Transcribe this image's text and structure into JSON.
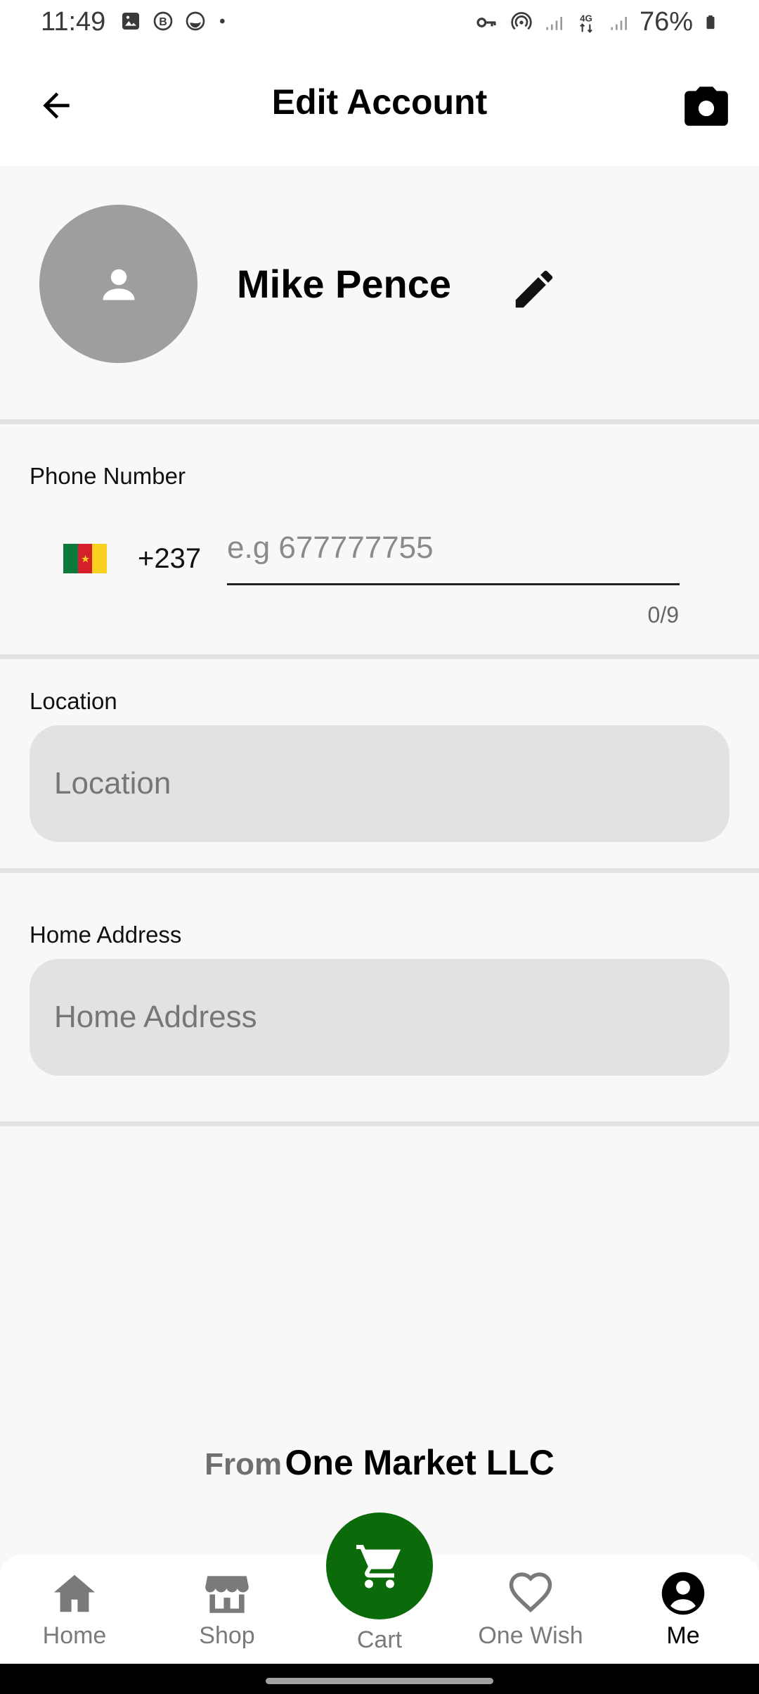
{
  "status_bar": {
    "time": "11:49",
    "battery": "76%",
    "icons_left": [
      "gallery-icon",
      "b-badge-icon",
      "vpn-app-icon",
      "dot-icon"
    ],
    "icons_right": [
      "key-icon",
      "hotspot-icon",
      "signal-icon",
      "4g-icon",
      "signal-icon-2",
      "battery-icon"
    ]
  },
  "app_bar": {
    "title": "Edit Account",
    "back_icon": "arrow-left-icon",
    "camera_icon": "camera-icon"
  },
  "profile": {
    "name": "Mike Pence",
    "avatar_icon": "person-icon",
    "edit_icon": "pencil-icon"
  },
  "phone": {
    "label": "Phone Number",
    "country_code": "+237",
    "flag": "cameroon-flag",
    "placeholder": "e.g 677777755",
    "value": "",
    "counter": "0/9"
  },
  "location": {
    "label": "Location",
    "placeholder": "Location",
    "value": ""
  },
  "home_address": {
    "label": "Home Address",
    "placeholder": "Home Address",
    "value": ""
  },
  "footer": {
    "prefix": "From",
    "company": "One Market LLC"
  },
  "bottom_nav": {
    "items": [
      {
        "label": "Home",
        "icon": "home-icon",
        "active": false
      },
      {
        "label": "Shop",
        "icon": "shop-icon",
        "active": false
      },
      {
        "label": "Cart",
        "icon": "cart-icon",
        "active": false
      },
      {
        "label": "One Wish",
        "icon": "heart-icon",
        "active": false
      },
      {
        "label": "Me",
        "icon": "account-circle-icon",
        "active": true
      }
    ],
    "cart_color": "#0b6b0b"
  },
  "colors": {
    "background": "#f8f8f8",
    "field_fill": "#e2e2e2",
    "accent_green": "#0b6b0b"
  }
}
